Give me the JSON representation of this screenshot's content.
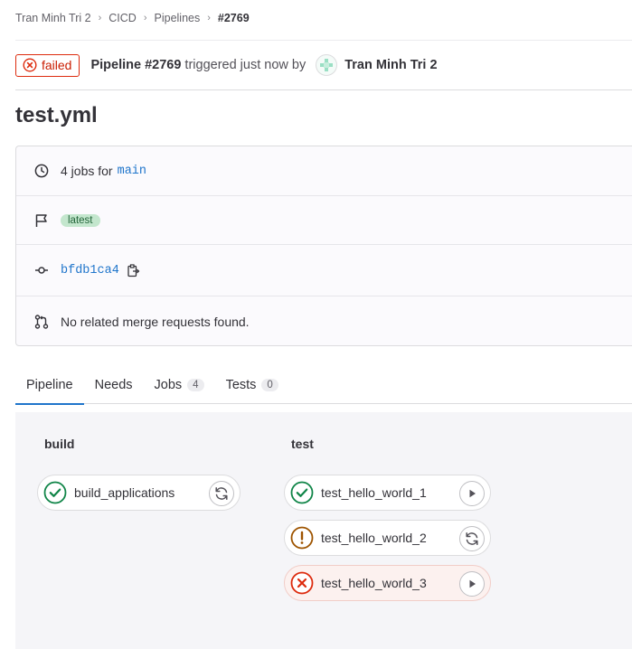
{
  "breadcrumb": [
    "Tran Minh Tri 2",
    "CICD",
    "Pipelines",
    "#2769"
  ],
  "header": {
    "status": "failed",
    "pipeline_label": "Pipeline #2769",
    "triggered_text": "triggered just now by",
    "user": "Tran Minh Tri 2"
  },
  "title": "test.yml",
  "info": {
    "jobs_prefix": "4 jobs for",
    "branch": "main",
    "tag": "latest",
    "commit": "bfdb1ca4",
    "merge_text": "No related merge requests found."
  },
  "tabs": [
    {
      "label": "Pipeline",
      "count": null
    },
    {
      "label": "Needs",
      "count": null
    },
    {
      "label": "Jobs",
      "count": "4"
    },
    {
      "label": "Tests",
      "count": "0"
    }
  ],
  "stages": [
    {
      "name": "build",
      "jobs": [
        {
          "name": "build_applications",
          "status": "success",
          "action": "retry"
        }
      ]
    },
    {
      "name": "test",
      "jobs": [
        {
          "name": "test_hello_world_1",
          "status": "success",
          "action": "play"
        },
        {
          "name": "test_hello_world_2",
          "status": "warning",
          "action": "retry"
        },
        {
          "name": "test_hello_world_3",
          "status": "failed",
          "action": "play"
        }
      ]
    }
  ],
  "colors": {
    "success": "#108548",
    "warning": "#9e5400",
    "failed": "#dd2b0e",
    "link": "#1f75cb"
  }
}
